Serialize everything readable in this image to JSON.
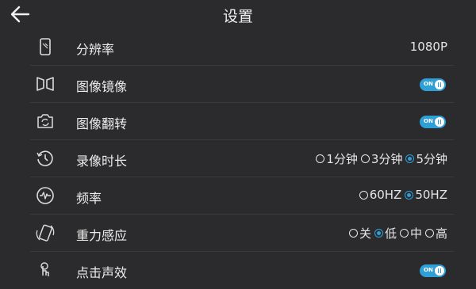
{
  "header": {
    "title": "设置",
    "back_icon": "back-arrow-icon"
  },
  "accent_color": "#2fa0d6",
  "settings": [
    {
      "icon": "phone-resolution-icon",
      "label": "分辨率",
      "value": "1080P"
    },
    {
      "icon": "mirror-icon",
      "label": "图像镜像",
      "toggle": {
        "text": "ON",
        "on": true
      }
    },
    {
      "icon": "camera-flip-icon",
      "label": "图像翻转",
      "toggle": {
        "text": "ON",
        "on": true
      }
    },
    {
      "icon": "clock-history-icon",
      "label": "录像时长",
      "options": [
        {
          "label": "1分钟",
          "selected": false
        },
        {
          "label": "3分钟",
          "selected": false
        },
        {
          "label": "5分钟",
          "selected": true
        }
      ]
    },
    {
      "icon": "frequency-wave-icon",
      "label": "频率",
      "options": [
        {
          "label": "60HZ",
          "selected": false
        },
        {
          "label": "50HZ",
          "selected": true
        }
      ]
    },
    {
      "icon": "gravity-sensor-icon",
      "label": "重力感应",
      "options": [
        {
          "label": "关",
          "selected": false
        },
        {
          "label": "低",
          "selected": true
        },
        {
          "label": "中",
          "selected": false
        },
        {
          "label": "高",
          "selected": false
        }
      ]
    },
    {
      "icon": "tap-sound-icon",
      "label": "点击声效",
      "toggle": {
        "text": "ON",
        "on": true
      }
    }
  ]
}
